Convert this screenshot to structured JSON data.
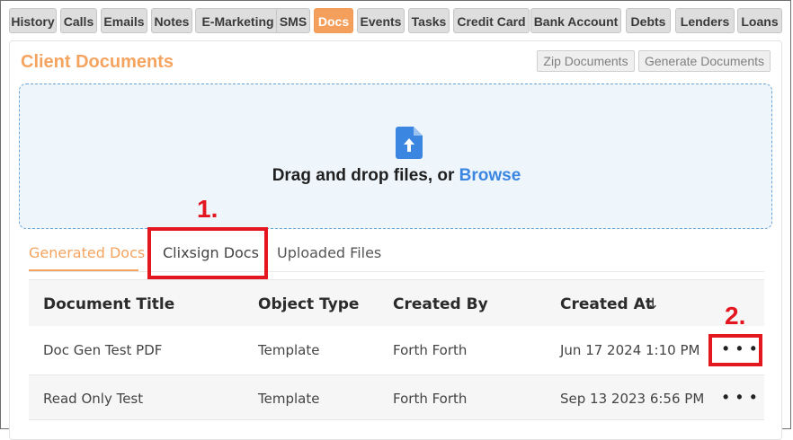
{
  "top_tabs": [
    "History",
    "Calls",
    "Emails",
    "Notes",
    "E-Marketing",
    "SMS",
    "Docs",
    "Events",
    "Tasks",
    "Credit Card",
    "Bank Account",
    "Debts",
    "Lenders",
    "Loans"
  ],
  "active_tab": "Docs",
  "card": {
    "title": "Client Documents",
    "zip_button": "Zip Documents",
    "generate_button": "Generate Documents"
  },
  "dropzone": {
    "text": "Drag and drop files, or ",
    "browse": "Browse"
  },
  "sub_tabs": {
    "generated": "Generated Docs",
    "clixsign": "Clixsign Docs",
    "uploaded": "Uploaded Files"
  },
  "table": {
    "headers": {
      "title": "Document Title",
      "object_type": "Object Type",
      "created_by": "Created By",
      "created_at": "Created At",
      "sort_arrow": "↓"
    },
    "rows": [
      {
        "title": "Doc Gen Test PDF",
        "object_type": "Template",
        "created_by": "Forth Forth",
        "created_at": "Jun 17 2024 1:10 PM",
        "actions": "• • •"
      },
      {
        "title": "Read Only Test",
        "object_type": "Template",
        "created_by": "Forth Forth",
        "created_at": "Sep 13 2023 6:56 PM",
        "actions": "• • •"
      }
    ]
  },
  "annotations": {
    "one": "1.",
    "two": "2."
  },
  "colors": {
    "accent_orange": "#f5a460",
    "browse_blue": "#3b86e0",
    "annotation_red": "#e4161f",
    "dropzone_bg": "#eef6fc"
  }
}
